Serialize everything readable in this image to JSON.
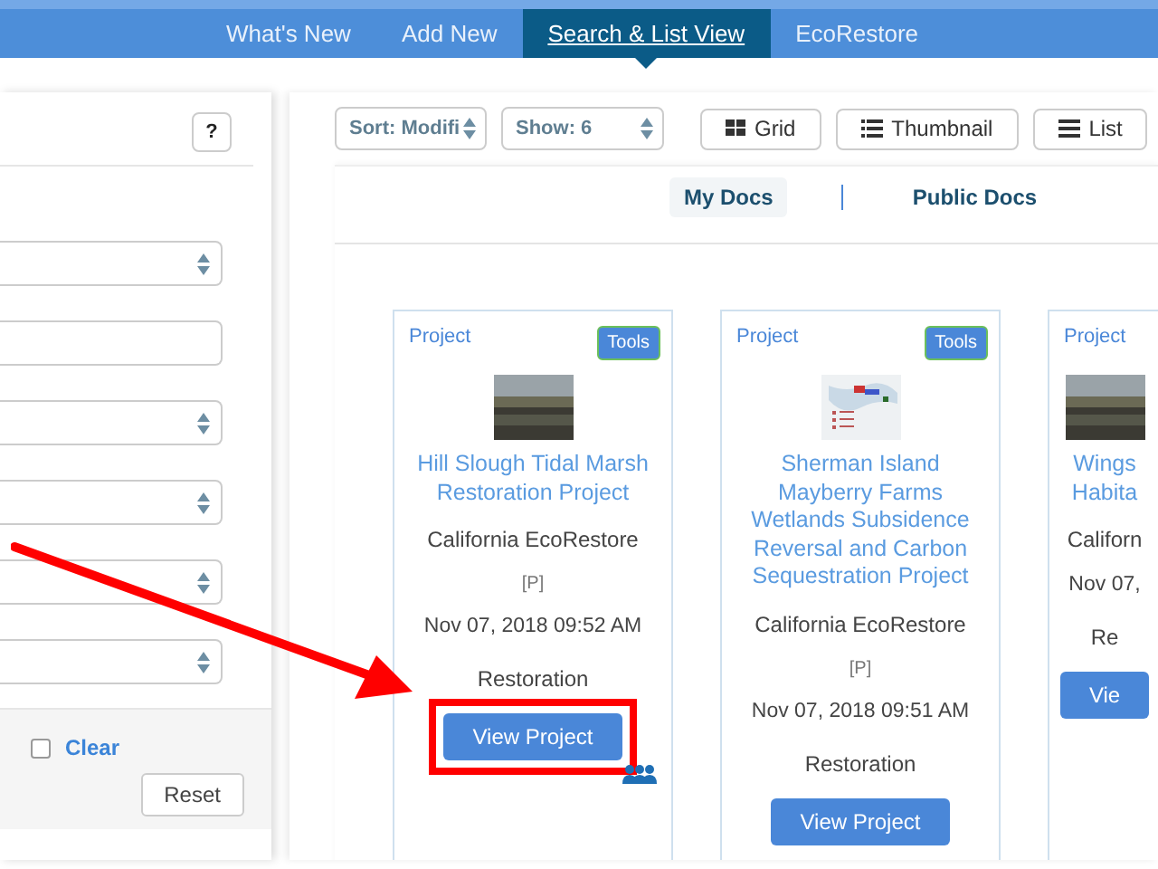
{
  "nav": {
    "tabs": [
      {
        "label": "What's New",
        "selected": false
      },
      {
        "label": "Add New",
        "selected": false
      },
      {
        "label": "Search & List View",
        "selected": true
      },
      {
        "label": "EcoRestore",
        "selected": false
      }
    ]
  },
  "filters": {
    "help_button": "?",
    "fields": [
      {
        "kind": "select"
      },
      {
        "kind": "text"
      },
      {
        "kind": "select"
      },
      {
        "kind": "select"
      },
      {
        "kind": "select"
      },
      {
        "kind": "select"
      }
    ],
    "clear": {
      "label": "Clear",
      "checked": false
    },
    "reset_button": "Reset"
  },
  "toolbar": {
    "sort": "Sort: Modifi",
    "show": "Show: 6",
    "views": [
      {
        "label": "Grid",
        "kind": "grid"
      },
      {
        "label": "Thumbnail",
        "kind": "thumbnail"
      },
      {
        "label": "List",
        "kind": "list"
      }
    ]
  },
  "doc_tabs": [
    {
      "label": "My Docs",
      "selected": true
    },
    {
      "label": "Public Docs",
      "selected": false
    }
  ],
  "cards": [
    {
      "type": "Project",
      "tools": "Tools",
      "thumbnail": {
        "kind": "photo"
      },
      "title": "Hill Slough Tidal Marsh Restoration Project",
      "organization": "California EcoRestore",
      "flag": "[P]",
      "date": "Nov 07, 2018 09:52 AM",
      "category": "Restoration",
      "button": "View Project",
      "highlighted": true,
      "shared": true
    },
    {
      "type": "Project",
      "tools": "Tools",
      "thumbnail": {
        "kind": "map"
      },
      "title": "Sherman Island Mayberry Farms Wetlands Subsidence Reversal and Carbon Sequestration Project",
      "organization": "California EcoRestore",
      "flag": "[P]",
      "date": "Nov 07, 2018 09:51 AM",
      "category": "Restoration",
      "button": "View Project",
      "highlighted": false,
      "shared": false
    },
    {
      "type": "Project",
      "thumbnail": {
        "kind": "photo"
      },
      "title": "Wings Habita",
      "organization": "Californ",
      "date": "Nov 07,",
      "category": "Re",
      "button": "Vie",
      "highlighted": false,
      "shared": false
    }
  ]
}
